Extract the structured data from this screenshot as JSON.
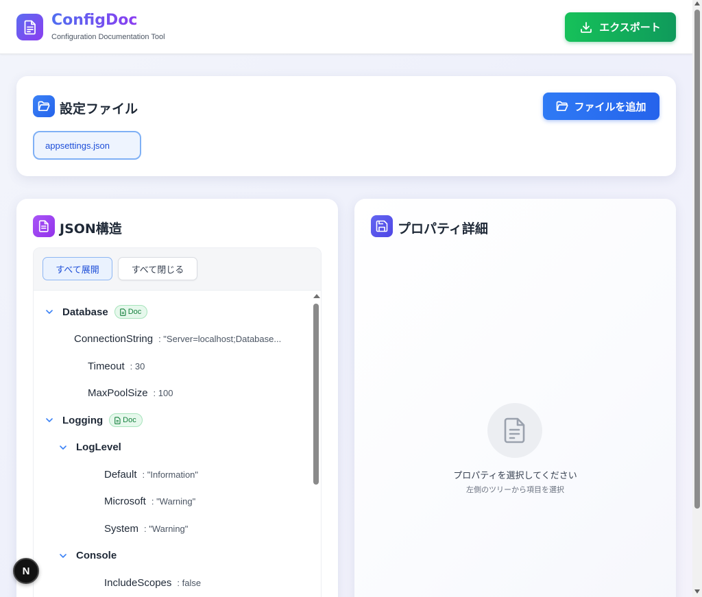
{
  "header": {
    "app_title": "ConfigDoc",
    "app_subtitle": "Configuration Documentation Tool",
    "export_label": "エクスポート",
    "brand_gradient": [
      "#5b6cf0",
      "#8b3df0"
    ],
    "export_color": "#16c15a"
  },
  "files_section": {
    "title": "設定ファイル",
    "add_file_label": "ファイルを追加",
    "files": [
      "appsettings.json"
    ],
    "accent": "#2563eb"
  },
  "tree_section": {
    "title": "JSON構造",
    "expand_all_label": "すべて展開",
    "collapse_all_label": "すべて閉じる",
    "doc_badge_label": "Doc",
    "nodes": [
      {
        "key": "Database",
        "value": "",
        "level": 0,
        "expanded": true,
        "has_doc": true,
        "is_object": true
      },
      {
        "key": "ConnectionString",
        "value": ": \"Server=localhost;Database...",
        "level": 1,
        "has_doc": false,
        "is_object": false
      },
      {
        "key": "Timeout",
        "value": ": 30",
        "level": 2,
        "has_doc": false,
        "is_object": false
      },
      {
        "key": "MaxPoolSize",
        "value": ": 100",
        "level": 2,
        "has_doc": false,
        "is_object": false
      },
      {
        "key": "Logging",
        "value": "",
        "level": 0,
        "expanded": true,
        "has_doc": true,
        "is_object": true
      },
      {
        "key": "LogLevel",
        "value": "",
        "level": 1,
        "expanded": true,
        "has_doc": false,
        "is_object": true
      },
      {
        "key": "Default",
        "value": ": \"Information\"",
        "level": 3,
        "has_doc": false,
        "is_object": false
      },
      {
        "key": "Microsoft",
        "value": ": \"Warning\"",
        "level": 3,
        "has_doc": false,
        "is_object": false
      },
      {
        "key": "System",
        "value": ": \"Warning\"",
        "level": 3,
        "has_doc": false,
        "is_object": false
      },
      {
        "key": "Console",
        "value": "",
        "level": 1,
        "expanded": true,
        "has_doc": false,
        "is_object": true
      },
      {
        "key": "IncludeScopes",
        "value": ": false",
        "level": 3,
        "has_doc": false,
        "is_object": false
      }
    ]
  },
  "props_section": {
    "title": "プロパティ詳細",
    "empty_title": "プロパティを選択してください",
    "empty_subtitle": "左側のツリーから項目を選択"
  },
  "overlay": {
    "next_badge_label": "N"
  }
}
